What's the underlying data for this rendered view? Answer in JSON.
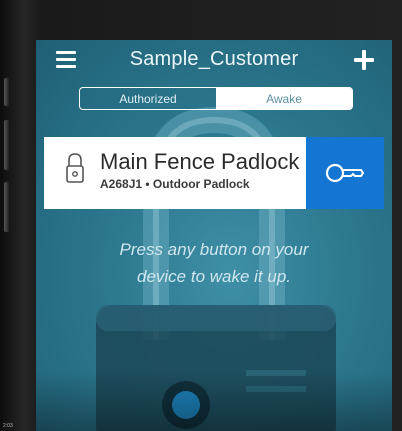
{
  "header": {
    "title": "Sample_Customer",
    "menu_icon": "hamburger-menu-icon",
    "add_icon": "plus-icon"
  },
  "tabs": [
    {
      "label": "Authorized",
      "active": false
    },
    {
      "label": "Awake",
      "active": true
    }
  ],
  "lock_card": {
    "name": "Main Fence Padlock",
    "meta": "A268J1 • Outdoor Padlock",
    "lock_icon": "padlock-icon",
    "key_icon": "key-icon"
  },
  "hint": {
    "line1": "Press any button on your",
    "line2": "device to wake it up."
  },
  "corner": "2:03",
  "colors": {
    "screen_bg": "#2d7a91",
    "accent_blue": "#1476d2",
    "card_bg": "#ffffff"
  }
}
